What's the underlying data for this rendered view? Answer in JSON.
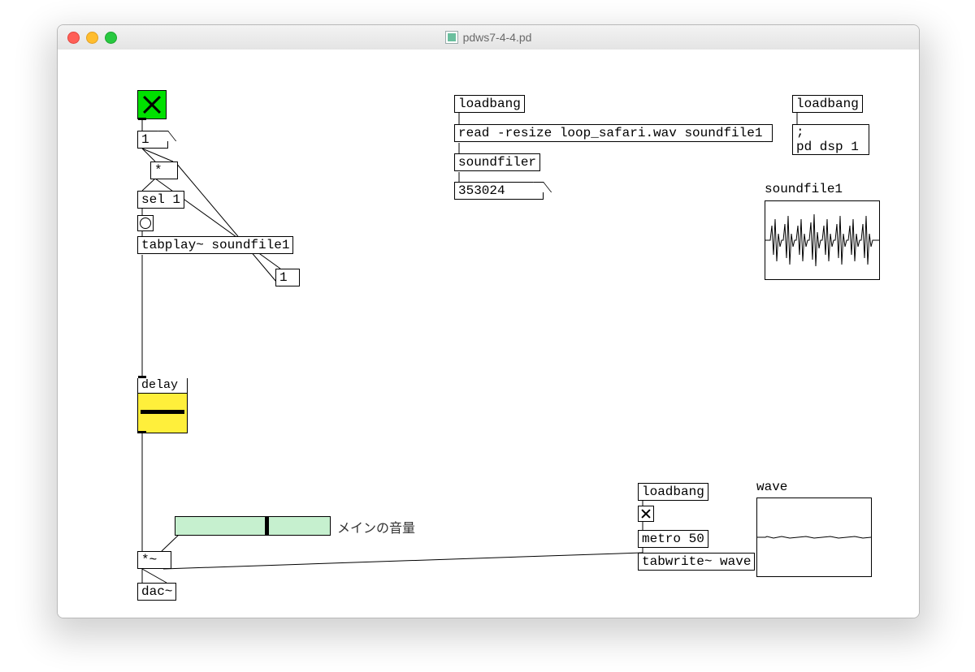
{
  "window": {
    "title": "pdws7-4-4.pd"
  },
  "toggle_main": {
    "checked": true
  },
  "num1": "1",
  "star_obj": "*",
  "sel_obj": "sel 1",
  "tabplay_obj": "tabplay~ soundfile1",
  "msg_one": "1",
  "delay_sub": "delay",
  "hslider": {
    "label": "メインの音量",
    "pos": 0.58
  },
  "mul_sig": "*~",
  "dac": "dac~",
  "loader": {
    "loadbang": "loadbang",
    "read_msg": "read -resize loop_safari.wav soundfile1",
    "soundfiler": "soundfiler",
    "samples": "353024"
  },
  "dsp": {
    "loadbang": "loadbang",
    "msg": ";\npd dsp 1"
  },
  "wave_chain": {
    "loadbang": "loadbang",
    "metro": "metro 50",
    "tabwrite": "tabwrite~ wave"
  },
  "arrays": {
    "soundfile1": "soundfile1",
    "wave": "wave"
  }
}
